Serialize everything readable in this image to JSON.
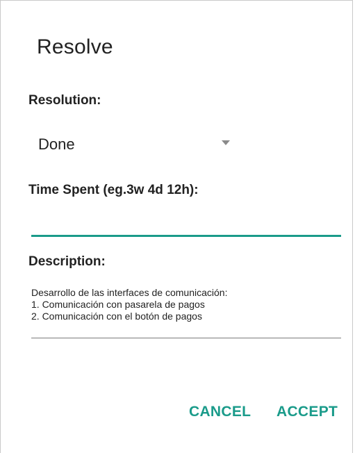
{
  "dialog": {
    "title": "Resolve",
    "resolution_label": "Resolution:",
    "resolution_value": "Done",
    "time_spent_label": "Time Spent (eg.3w 4d 12h):",
    "time_spent_value": "",
    "description_label": "Description:",
    "description_lines": [
      "Desarrollo de las interfaces de comunicación:",
      "1. Comunicación con pasarela de pagos",
      "2. Comunicación con el botón de pagos"
    ],
    "cancel_label": "CANCEL",
    "accept_label": "ACCEPT"
  },
  "colors": {
    "accent": "#1a9b8a",
    "text": "#222222",
    "dropdown_arrow": "#8a8a8a"
  },
  "icons": {
    "dropdown": "triangle-down-icon"
  }
}
